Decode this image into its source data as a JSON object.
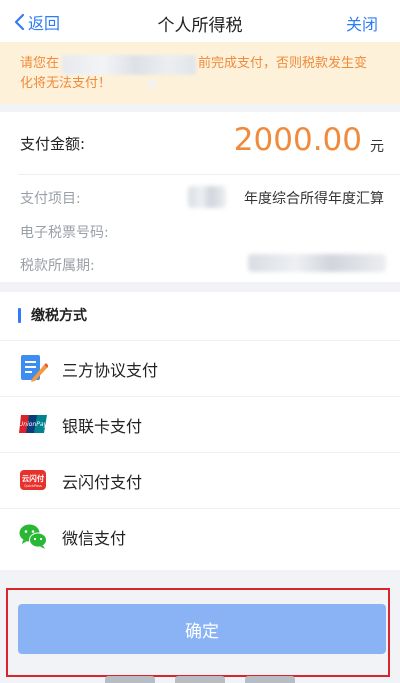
{
  "nav": {
    "back_label": "返回",
    "title": "个人所得税",
    "close_label": "关闭"
  },
  "notice": {
    "prefix": "请您在",
    "suffix": "前完成支付，否则税款发生变",
    "line2": "化将无法支付！"
  },
  "payment": {
    "amount_label": "支付金额:",
    "amount_value": "2000.00",
    "amount_unit": "元",
    "item_label": "支付项目:",
    "item_value": "年度综合所得年度汇算",
    "ticket_label": "电子税票号码:",
    "period_label": "税款所属期:"
  },
  "methods": {
    "section_title": "缴税方式",
    "items": [
      {
        "label": "三方协议支付",
        "icon": "document-pen-icon"
      },
      {
        "label": "银联卡支付",
        "icon": "unionpay-icon"
      },
      {
        "label": "云闪付支付",
        "icon": "cloud-quickpass-icon"
      },
      {
        "label": "微信支付",
        "icon": "wechat-icon"
      }
    ]
  },
  "footer": {
    "confirm_label": "确定"
  },
  "colors": {
    "accent": "#2f7cf6",
    "amount": "#f08a3c",
    "notice_bg": "#fdf2d9",
    "button": "#8ab3f5",
    "highlight_frame": "#d6262c"
  }
}
